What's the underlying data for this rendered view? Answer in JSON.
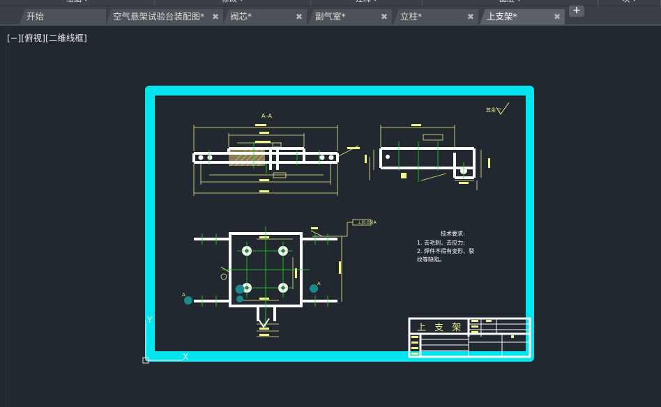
{
  "ribbon": {
    "panels": [
      {
        "label": "绘图 ▾"
      },
      {
        "label": "修改 ▾"
      },
      {
        "label": "注释 ▾"
      },
      {
        "label": "图层 ▾"
      },
      {
        "label": "块 ▾"
      }
    ]
  },
  "tabs": [
    {
      "label": "开始",
      "closable": false,
      "active": false
    },
    {
      "label": "空气悬架试验台装配图*",
      "closable": true,
      "active": false
    },
    {
      "label": "阀芯*",
      "closable": true,
      "active": false
    },
    {
      "label": "副气室*",
      "closable": true,
      "active": false
    },
    {
      "label": "立柱*",
      "closable": true,
      "active": false
    },
    {
      "label": "上支架*",
      "closable": true,
      "active": true
    }
  ],
  "new_tab_symbol": "+",
  "close_symbol": "✖",
  "viewport": {
    "controls_label": "[−][俯视][二维线框]"
  },
  "drawing": {
    "section_label": "A–A",
    "roughness_symbol": "其余 ▽",
    "tech_requirements": {
      "heading": "技术要求:",
      "items": [
        "1.   去毛刺，去应力;",
        "2.   焊件不得有变形、裂",
        "     纹等缺陷。"
      ]
    },
    "title_block_name": "上 支 架",
    "ucs_y": "Y",
    "ucs_x": "X",
    "section_marker": "A"
  },
  "colors": {
    "frame": "#00e5ee",
    "part": "#ffffff",
    "dimension": "#f2f28a",
    "centerline": "#22dd22",
    "hatch": "#b8a878",
    "teal_mark": "#1a8a8a"
  }
}
